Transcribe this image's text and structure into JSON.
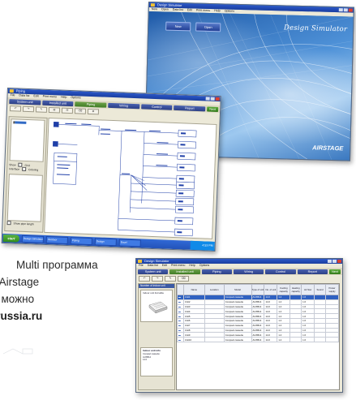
{
  "caption": {
    "line1": "Multi программа",
    "line2": "тем Airstage",
    "line3": "гда можно",
    "line4": "l-russia.ru"
  },
  "splash_window": {
    "title": "Design Simulator",
    "menu": [
      "New",
      "Open",
      "Data list",
      "Edit",
      "Print menu",
      "Help",
      "Options"
    ],
    "new_button": "New",
    "open_button": "Open",
    "brand": "Design Simulator",
    "logo": "AIRSTAGE"
  },
  "piping_window": {
    "title": "Piping",
    "menu": [
      "File",
      "Data list",
      "Edit",
      "Print menu",
      "Help",
      "Options"
    ],
    "tabs": [
      "System unit",
      "Installed unit",
      "Piping",
      "Wiring",
      "Control",
      "Report",
      "Next"
    ],
    "active_tab": "Piping",
    "tools": [
      "↶",
      "↷",
      "✎",
      "⊞",
      "⊟",
      "⌫",
      "⊕"
    ],
    "checkbox_a": "Show",
    "checkbox_b": "Grid",
    "checkbox_c": "Interface",
    "checkbox_d": "Coloring",
    "checkbox_e": "Show pipe length",
    "taskbar": {
      "start": "start",
      "tasks": [
        "Design Simulator",
        "Outdoor",
        "Piping",
        "Design",
        "Excel"
      ],
      "clock": "4:53 PM"
    }
  },
  "table_window": {
    "title": "Design Simulator",
    "menu": [
      "File",
      "Data list",
      "Edit",
      "Print menu",
      "Help",
      "Options"
    ],
    "tabs": [
      "System unit",
      "Installed unit",
      "Piping",
      "Wiring",
      "Control",
      "Report",
      "Next"
    ],
    "active_tab": "Installed unit",
    "side_header": "Number of indoor unit",
    "side_subheader": "Indoor unit list table",
    "unit_info_header": "Indoor unit info",
    "columns": [
      "Name",
      "Location",
      "Model",
      "Type of unit",
      "No. of unit",
      "Cooling capacity",
      "Heating capacity",
      "Air flow",
      "Sound",
      "Power supply"
    ],
    "rows": [
      [
        "Unit1",
        "",
        "Compact cassette",
        "AUXB14",
        "14.0",
        "1.4",
        "",
        "1.6",
        "",
        ""
      ],
      [
        "Unit2",
        "",
        "Compact cassette",
        "AUXB14",
        "14.0",
        "1.4",
        "",
        "1.6",
        "",
        ""
      ],
      [
        "Unit3",
        "",
        "Compact cassette",
        "AUXB14",
        "14.0",
        "1.4",
        "",
        "1.6",
        "",
        ""
      ],
      [
        "Unit4",
        "",
        "Compact cassette",
        "AUXB14",
        "14.0",
        "1.4",
        "",
        "1.6",
        "",
        ""
      ],
      [
        "Unit5",
        "",
        "Compact cassette",
        "AUXB14",
        "14.0",
        "1.4",
        "",
        "1.6",
        "",
        ""
      ],
      [
        "Unit6",
        "",
        "Compact cassette",
        "AUXB14",
        "14.0",
        "1.4",
        "",
        "1.6",
        "",
        ""
      ],
      [
        "Unit7",
        "",
        "Compact cassette",
        "AUXB14",
        "14.0",
        "1.4",
        "",
        "1.6",
        "",
        ""
      ],
      [
        "Unit8",
        "",
        "Compact cassette",
        "AUXB14",
        "14.0",
        "1.4",
        "",
        "1.6",
        "",
        ""
      ],
      [
        "Unit9",
        "",
        "Compact cassette",
        "AUXB14",
        "14.0",
        "1.4",
        "",
        "1.6",
        "",
        ""
      ],
      [
        "Unit10",
        "",
        "Compact cassette",
        "AUXB14",
        "14.0",
        "1.4",
        "",
        "1.6",
        "",
        ""
      ]
    ],
    "selected_row": 0
  }
}
